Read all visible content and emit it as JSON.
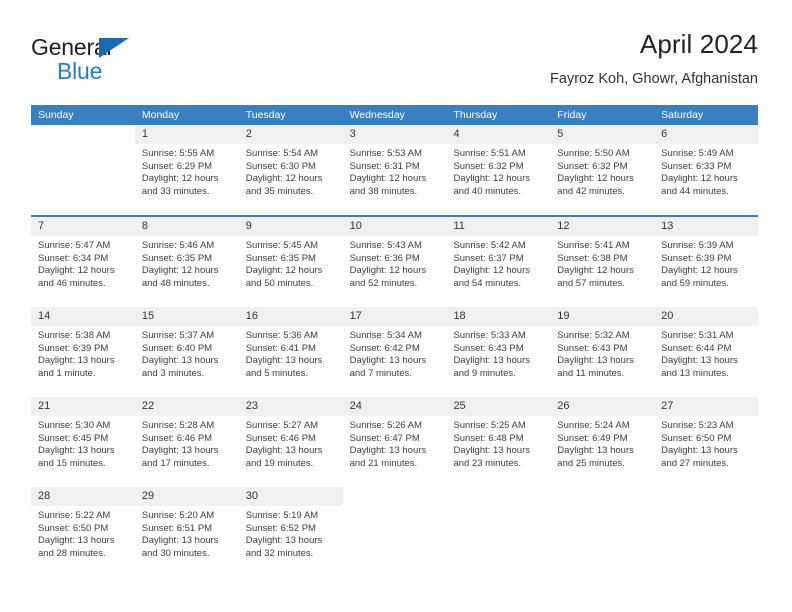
{
  "brand": {
    "name_top": "General",
    "name_bottom": "Blue",
    "triangle_icon": "brand-triangle-icon",
    "colors": {
      "dark": "#231f20",
      "blue": "#1c7fd4",
      "triangle": "#1c6bb0"
    }
  },
  "header": {
    "title": "April 2024",
    "subtitle": "Fayroz Koh, Ghowr, Afghanistan"
  },
  "theme": {
    "header_bar": "#3a7fc0",
    "day_band": "#f0f0f0",
    "text": "#3c3c3c"
  },
  "weekday_headers": [
    "Sunday",
    "Monday",
    "Tuesday",
    "Wednesday",
    "Thursday",
    "Friday",
    "Saturday"
  ],
  "weeks": [
    [
      {
        "day": "",
        "lines": []
      },
      {
        "day": "1",
        "lines": [
          "Sunrise: 5:55 AM",
          "Sunset: 6:29 PM",
          "Daylight: 12 hours",
          "and 33 minutes."
        ]
      },
      {
        "day": "2",
        "lines": [
          "Sunrise: 5:54 AM",
          "Sunset: 6:30 PM",
          "Daylight: 12 hours",
          "and 35 minutes."
        ]
      },
      {
        "day": "3",
        "lines": [
          "Sunrise: 5:53 AM",
          "Sunset: 6:31 PM",
          "Daylight: 12 hours",
          "and 38 minutes."
        ]
      },
      {
        "day": "4",
        "lines": [
          "Sunrise: 5:51 AM",
          "Sunset: 6:32 PM",
          "Daylight: 12 hours",
          "and 40 minutes."
        ]
      },
      {
        "day": "5",
        "lines": [
          "Sunrise: 5:50 AM",
          "Sunset: 6:32 PM",
          "Daylight: 12 hours",
          "and 42 minutes."
        ]
      },
      {
        "day": "6",
        "lines": [
          "Sunrise: 5:49 AM",
          "Sunset: 6:33 PM",
          "Daylight: 12 hours",
          "and 44 minutes."
        ]
      }
    ],
    [
      {
        "day": "7",
        "lines": [
          "Sunrise: 5:47 AM",
          "Sunset: 6:34 PM",
          "Daylight: 12 hours",
          "and 46 minutes."
        ]
      },
      {
        "day": "8",
        "lines": [
          "Sunrise: 5:46 AM",
          "Sunset: 6:35 PM",
          "Daylight: 12 hours",
          "and 48 minutes."
        ]
      },
      {
        "day": "9",
        "lines": [
          "Sunrise: 5:45 AM",
          "Sunset: 6:35 PM",
          "Daylight: 12 hours",
          "and 50 minutes."
        ]
      },
      {
        "day": "10",
        "lines": [
          "Sunrise: 5:43 AM",
          "Sunset: 6:36 PM",
          "Daylight: 12 hours",
          "and 52 minutes."
        ]
      },
      {
        "day": "11",
        "lines": [
          "Sunrise: 5:42 AM",
          "Sunset: 6:37 PM",
          "Daylight: 12 hours",
          "and 54 minutes."
        ]
      },
      {
        "day": "12",
        "lines": [
          "Sunrise: 5:41 AM",
          "Sunset: 6:38 PM",
          "Daylight: 12 hours",
          "and 57 minutes."
        ]
      },
      {
        "day": "13",
        "lines": [
          "Sunrise: 5:39 AM",
          "Sunset: 6:39 PM",
          "Daylight: 12 hours",
          "and 59 minutes."
        ]
      }
    ],
    [
      {
        "day": "14",
        "lines": [
          "Sunrise: 5:38 AM",
          "Sunset: 6:39 PM",
          "Daylight: 13 hours",
          "and 1 minute."
        ]
      },
      {
        "day": "15",
        "lines": [
          "Sunrise: 5:37 AM",
          "Sunset: 6:40 PM",
          "Daylight: 13 hours",
          "and 3 minutes."
        ]
      },
      {
        "day": "16",
        "lines": [
          "Sunrise: 5:36 AM",
          "Sunset: 6:41 PM",
          "Daylight: 13 hours",
          "and 5 minutes."
        ]
      },
      {
        "day": "17",
        "lines": [
          "Sunrise: 5:34 AM",
          "Sunset: 6:42 PM",
          "Daylight: 13 hours",
          "and 7 minutes."
        ]
      },
      {
        "day": "18",
        "lines": [
          "Sunrise: 5:33 AM",
          "Sunset: 6:43 PM",
          "Daylight: 13 hours",
          "and 9 minutes."
        ]
      },
      {
        "day": "19",
        "lines": [
          "Sunrise: 5:32 AM",
          "Sunset: 6:43 PM",
          "Daylight: 13 hours",
          "and 11 minutes."
        ]
      },
      {
        "day": "20",
        "lines": [
          "Sunrise: 5:31 AM",
          "Sunset: 6:44 PM",
          "Daylight: 13 hours",
          "and 13 minutes."
        ]
      }
    ],
    [
      {
        "day": "21",
        "lines": [
          "Sunrise: 5:30 AM",
          "Sunset: 6:45 PM",
          "Daylight: 13 hours",
          "and 15 minutes."
        ]
      },
      {
        "day": "22",
        "lines": [
          "Sunrise: 5:28 AM",
          "Sunset: 6:46 PM",
          "Daylight: 13 hours",
          "and 17 minutes."
        ]
      },
      {
        "day": "23",
        "lines": [
          "Sunrise: 5:27 AM",
          "Sunset: 6:46 PM",
          "Daylight: 13 hours",
          "and 19 minutes."
        ]
      },
      {
        "day": "24",
        "lines": [
          "Sunrise: 5:26 AM",
          "Sunset: 6:47 PM",
          "Daylight: 13 hours",
          "and 21 minutes."
        ]
      },
      {
        "day": "25",
        "lines": [
          "Sunrise: 5:25 AM",
          "Sunset: 6:48 PM",
          "Daylight: 13 hours",
          "and 23 minutes."
        ]
      },
      {
        "day": "26",
        "lines": [
          "Sunrise: 5:24 AM",
          "Sunset: 6:49 PM",
          "Daylight: 13 hours",
          "and 25 minutes."
        ]
      },
      {
        "day": "27",
        "lines": [
          "Sunrise: 5:23 AM",
          "Sunset: 6:50 PM",
          "Daylight: 13 hours",
          "and 27 minutes."
        ]
      }
    ],
    [
      {
        "day": "28",
        "lines": [
          "Sunrise: 5:22 AM",
          "Sunset: 6:50 PM",
          "Daylight: 13 hours",
          "and 28 minutes."
        ]
      },
      {
        "day": "29",
        "lines": [
          "Sunrise: 5:20 AM",
          "Sunset: 6:51 PM",
          "Daylight: 13 hours",
          "and 30 minutes."
        ]
      },
      {
        "day": "30",
        "lines": [
          "Sunrise: 5:19 AM",
          "Sunset: 6:52 PM",
          "Daylight: 13 hours",
          "and 32 minutes."
        ]
      },
      {
        "day": "",
        "lines": []
      },
      {
        "day": "",
        "lines": []
      },
      {
        "day": "",
        "lines": []
      },
      {
        "day": "",
        "lines": []
      }
    ]
  ]
}
